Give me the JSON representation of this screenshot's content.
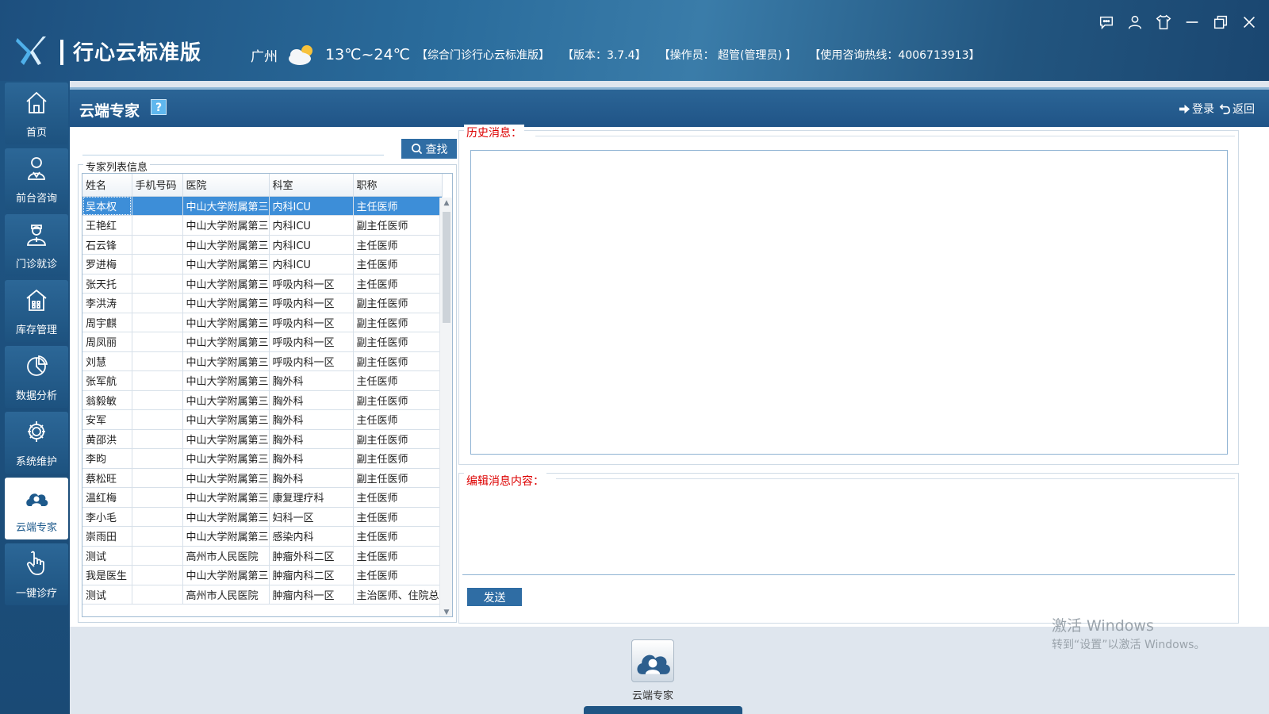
{
  "header": {
    "app_title": "行心云标准版",
    "city": "广州",
    "temperature": "13℃~24℃",
    "edition": "【综合门诊行心云标准版】",
    "version": "【版本：3.7.4】",
    "operator": "【操作员：  超管(管理员) 】",
    "hotline": "【使用咨询热线：4006713913】",
    "colors": {
      "bar_start": "#1d4f7e",
      "bar_mid": "#3a7ca9"
    }
  },
  "nav": {
    "items": [
      {
        "label": "首页",
        "icon": "home-icon"
      },
      {
        "label": "前台咨询",
        "icon": "reception-icon"
      },
      {
        "label": "门诊就诊",
        "icon": "doctor-icon"
      },
      {
        "label": "库存管理",
        "icon": "warehouse-icon"
      },
      {
        "label": "数据分析",
        "icon": "pie-chart-icon"
      },
      {
        "label": "系统维护",
        "icon": "gear-icon"
      },
      {
        "label": "云端专家",
        "icon": "cloud-expert-icon"
      },
      {
        "label": "一键诊疗",
        "icon": "hand-pointer-icon"
      }
    ],
    "active_index": 6
  },
  "page": {
    "title": "云端专家",
    "help": "?",
    "login": "登录",
    "back": "返回"
  },
  "search": {
    "button": "查找",
    "value": ""
  },
  "expert_list": {
    "group_label": "专家列表信息",
    "columns": [
      "姓名",
      "手机号码",
      "医院",
      "科室",
      "职称"
    ],
    "rows": [
      [
        "吴本权",
        "",
        "中山大学附属第三",
        "内科ICU",
        "主任医师"
      ],
      [
        "王艳红",
        "",
        "中山大学附属第三",
        "内科ICU",
        "副主任医师"
      ],
      [
        "石云锋",
        "",
        "中山大学附属第三",
        "内科ICU",
        "主任医师"
      ],
      [
        "罗进梅",
        "",
        "中山大学附属第三",
        "内科ICU",
        "主任医师"
      ],
      [
        "张天托",
        "",
        "中山大学附属第三",
        "呼吸内科一区",
        "主任医师"
      ],
      [
        "李洪涛",
        "",
        "中山大学附属第三",
        "呼吸内科一区",
        "副主任医师"
      ],
      [
        "周宇麒",
        "",
        "中山大学附属第三",
        "呼吸内科一区",
        "副主任医师"
      ],
      [
        "周凤丽",
        "",
        "中山大学附属第三",
        "呼吸内科一区",
        "副主任医师"
      ],
      [
        "刘慧",
        "",
        "中山大学附属第三",
        "呼吸内科一区",
        "副主任医师"
      ],
      [
        "张军航",
        "",
        "中山大学附属第三",
        "胸外科",
        "主任医师"
      ],
      [
        "翁毅敏",
        "",
        "中山大学附属第三",
        "胸外科",
        "副主任医师"
      ],
      [
        "安军",
        "",
        "中山大学附属第三",
        "胸外科",
        "主任医师"
      ],
      [
        "黄邵洪",
        "",
        "中山大学附属第三",
        "胸外科",
        "副主任医师"
      ],
      [
        "李昀",
        "",
        "中山大学附属第三",
        "胸外科",
        "副主任医师"
      ],
      [
        "蔡松旺",
        "",
        "中山大学附属第三",
        "胸外科",
        "副主任医师"
      ],
      [
        "温红梅",
        "",
        "中山大学附属第三",
        "康复理疗科",
        "主任医师"
      ],
      [
        "李小毛",
        "",
        "中山大学附属第三",
        "妇科一区",
        "主任医师"
      ],
      [
        "崇雨田",
        "",
        "中山大学附属第三",
        "感染内科",
        "主任医师"
      ],
      [
        "测试",
        "",
        "高州市人民医院",
        "肿瘤外科二区",
        "主任医师"
      ],
      [
        "我是医生",
        "",
        "中山大学附属第三",
        "肿瘤内科二区",
        "主任医师"
      ],
      [
        "测试",
        "",
        "高州市人民医院",
        "肿瘤内科一区",
        "主治医师、住院总"
      ]
    ],
    "selected_index": 0
  },
  "history": {
    "label": "历史消息："
  },
  "edit": {
    "label": "编辑消息内容：",
    "value": "",
    "send": "发送"
  },
  "dock": {
    "label": "云端专家"
  },
  "watermark": {
    "line1": "激活 Windows",
    "line2": "转到“设置”以激活 Windows。"
  }
}
